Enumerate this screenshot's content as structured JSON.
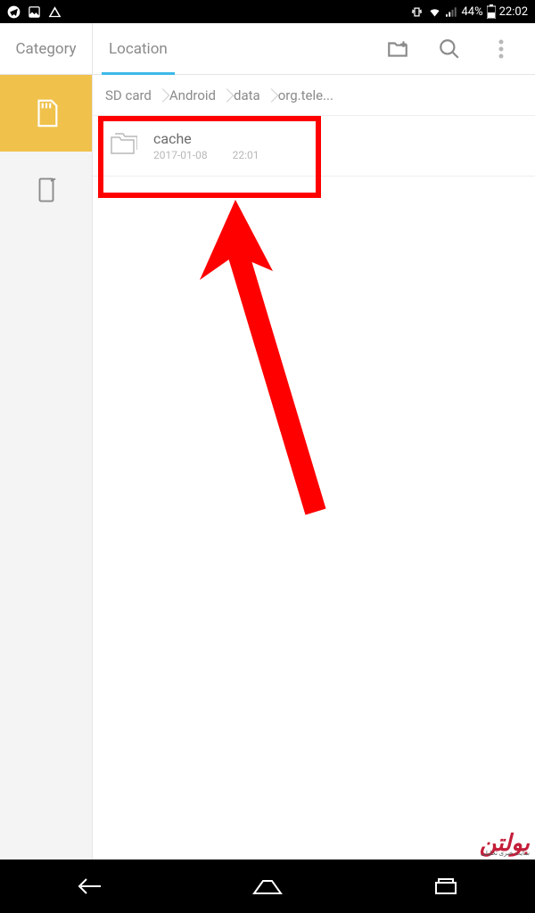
{
  "status": {
    "battery_text": "44%",
    "time": "22:02"
  },
  "tabs": {
    "category": "Category",
    "location": "Location"
  },
  "breadcrumb": [
    "SD card",
    "Android",
    "data",
    "org.tele..."
  ],
  "files": [
    {
      "name": "cache",
      "date": "2017-01-08",
      "time": "22:01"
    }
  ],
  "watermark": {
    "main": "بولتن",
    "sub": "سایت خبری تحلیلی"
  }
}
